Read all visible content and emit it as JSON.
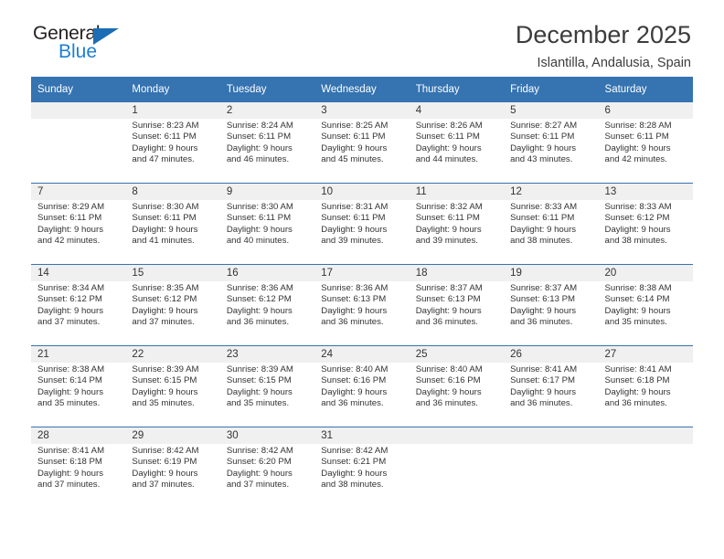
{
  "brand": {
    "name_top": "General",
    "name_bottom": "Blue",
    "accent_color": "#1b6eb5"
  },
  "header": {
    "title": "December 2025",
    "subtitle": "Islantilla, Andalusia, Spain"
  },
  "theme": {
    "header_bg": "#3573b1",
    "daynum_bg": "#f0f0f0",
    "cell_bg": "#ffffff",
    "text": "#333333"
  },
  "weekday_headers": [
    "Sunday",
    "Monday",
    "Tuesday",
    "Wednesday",
    "Thursday",
    "Friday",
    "Saturday"
  ],
  "weeks": [
    [
      {
        "day": "",
        "lines": [
          "",
          "",
          "",
          ""
        ]
      },
      {
        "day": "1",
        "lines": [
          "Sunrise: 8:23 AM",
          "Sunset: 6:11 PM",
          "Daylight: 9 hours",
          "and 47 minutes."
        ]
      },
      {
        "day": "2",
        "lines": [
          "Sunrise: 8:24 AM",
          "Sunset: 6:11 PM",
          "Daylight: 9 hours",
          "and 46 minutes."
        ]
      },
      {
        "day": "3",
        "lines": [
          "Sunrise: 8:25 AM",
          "Sunset: 6:11 PM",
          "Daylight: 9 hours",
          "and 45 minutes."
        ]
      },
      {
        "day": "4",
        "lines": [
          "Sunrise: 8:26 AM",
          "Sunset: 6:11 PM",
          "Daylight: 9 hours",
          "and 44 minutes."
        ]
      },
      {
        "day": "5",
        "lines": [
          "Sunrise: 8:27 AM",
          "Sunset: 6:11 PM",
          "Daylight: 9 hours",
          "and 43 minutes."
        ]
      },
      {
        "day": "6",
        "lines": [
          "Sunrise: 8:28 AM",
          "Sunset: 6:11 PM",
          "Daylight: 9 hours",
          "and 42 minutes."
        ]
      }
    ],
    [
      {
        "day": "7",
        "lines": [
          "Sunrise: 8:29 AM",
          "Sunset: 6:11 PM",
          "Daylight: 9 hours",
          "and 42 minutes."
        ]
      },
      {
        "day": "8",
        "lines": [
          "Sunrise: 8:30 AM",
          "Sunset: 6:11 PM",
          "Daylight: 9 hours",
          "and 41 minutes."
        ]
      },
      {
        "day": "9",
        "lines": [
          "Sunrise: 8:30 AM",
          "Sunset: 6:11 PM",
          "Daylight: 9 hours",
          "and 40 minutes."
        ]
      },
      {
        "day": "10",
        "lines": [
          "Sunrise: 8:31 AM",
          "Sunset: 6:11 PM",
          "Daylight: 9 hours",
          "and 39 minutes."
        ]
      },
      {
        "day": "11",
        "lines": [
          "Sunrise: 8:32 AM",
          "Sunset: 6:11 PM",
          "Daylight: 9 hours",
          "and 39 minutes."
        ]
      },
      {
        "day": "12",
        "lines": [
          "Sunrise: 8:33 AM",
          "Sunset: 6:11 PM",
          "Daylight: 9 hours",
          "and 38 minutes."
        ]
      },
      {
        "day": "13",
        "lines": [
          "Sunrise: 8:33 AM",
          "Sunset: 6:12 PM",
          "Daylight: 9 hours",
          "and 38 minutes."
        ]
      }
    ],
    [
      {
        "day": "14",
        "lines": [
          "Sunrise: 8:34 AM",
          "Sunset: 6:12 PM",
          "Daylight: 9 hours",
          "and 37 minutes."
        ]
      },
      {
        "day": "15",
        "lines": [
          "Sunrise: 8:35 AM",
          "Sunset: 6:12 PM",
          "Daylight: 9 hours",
          "and 37 minutes."
        ]
      },
      {
        "day": "16",
        "lines": [
          "Sunrise: 8:36 AM",
          "Sunset: 6:12 PM",
          "Daylight: 9 hours",
          "and 36 minutes."
        ]
      },
      {
        "day": "17",
        "lines": [
          "Sunrise: 8:36 AM",
          "Sunset: 6:13 PM",
          "Daylight: 9 hours",
          "and 36 minutes."
        ]
      },
      {
        "day": "18",
        "lines": [
          "Sunrise: 8:37 AM",
          "Sunset: 6:13 PM",
          "Daylight: 9 hours",
          "and 36 minutes."
        ]
      },
      {
        "day": "19",
        "lines": [
          "Sunrise: 8:37 AM",
          "Sunset: 6:13 PM",
          "Daylight: 9 hours",
          "and 36 minutes."
        ]
      },
      {
        "day": "20",
        "lines": [
          "Sunrise: 8:38 AM",
          "Sunset: 6:14 PM",
          "Daylight: 9 hours",
          "and 35 minutes."
        ]
      }
    ],
    [
      {
        "day": "21",
        "lines": [
          "Sunrise: 8:38 AM",
          "Sunset: 6:14 PM",
          "Daylight: 9 hours",
          "and 35 minutes."
        ]
      },
      {
        "day": "22",
        "lines": [
          "Sunrise: 8:39 AM",
          "Sunset: 6:15 PM",
          "Daylight: 9 hours",
          "and 35 minutes."
        ]
      },
      {
        "day": "23",
        "lines": [
          "Sunrise: 8:39 AM",
          "Sunset: 6:15 PM",
          "Daylight: 9 hours",
          "and 35 minutes."
        ]
      },
      {
        "day": "24",
        "lines": [
          "Sunrise: 8:40 AM",
          "Sunset: 6:16 PM",
          "Daylight: 9 hours",
          "and 36 minutes."
        ]
      },
      {
        "day": "25",
        "lines": [
          "Sunrise: 8:40 AM",
          "Sunset: 6:16 PM",
          "Daylight: 9 hours",
          "and 36 minutes."
        ]
      },
      {
        "day": "26",
        "lines": [
          "Sunrise: 8:41 AM",
          "Sunset: 6:17 PM",
          "Daylight: 9 hours",
          "and 36 minutes."
        ]
      },
      {
        "day": "27",
        "lines": [
          "Sunrise: 8:41 AM",
          "Sunset: 6:18 PM",
          "Daylight: 9 hours",
          "and 36 minutes."
        ]
      }
    ],
    [
      {
        "day": "28",
        "lines": [
          "Sunrise: 8:41 AM",
          "Sunset: 6:18 PM",
          "Daylight: 9 hours",
          "and 37 minutes."
        ]
      },
      {
        "day": "29",
        "lines": [
          "Sunrise: 8:42 AM",
          "Sunset: 6:19 PM",
          "Daylight: 9 hours",
          "and 37 minutes."
        ]
      },
      {
        "day": "30",
        "lines": [
          "Sunrise: 8:42 AM",
          "Sunset: 6:20 PM",
          "Daylight: 9 hours",
          "and 37 minutes."
        ]
      },
      {
        "day": "31",
        "lines": [
          "Sunrise: 8:42 AM",
          "Sunset: 6:21 PM",
          "Daylight: 9 hours",
          "and 38 minutes."
        ]
      },
      {
        "day": "",
        "lines": [
          "",
          "",
          "",
          ""
        ]
      },
      {
        "day": "",
        "lines": [
          "",
          "",
          "",
          ""
        ]
      },
      {
        "day": "",
        "lines": [
          "",
          "",
          "",
          ""
        ]
      }
    ]
  ]
}
